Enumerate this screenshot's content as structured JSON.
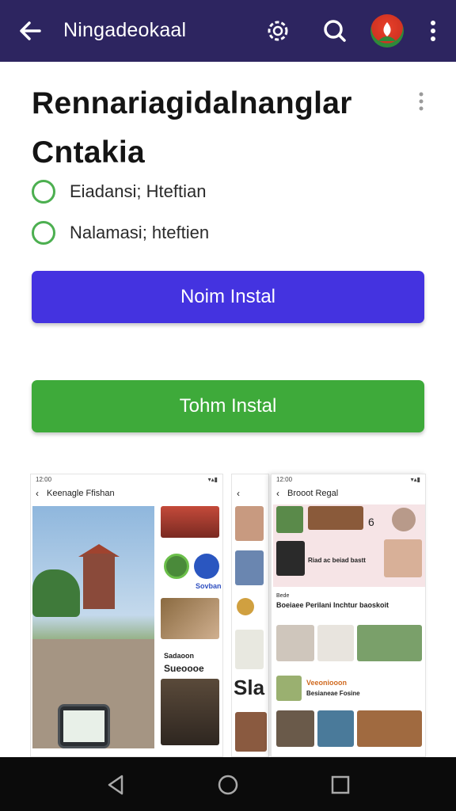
{
  "appbar": {
    "title": "Ningadeokaal",
    "icons": [
      "back-arrow-icon",
      "gear-icon",
      "search-icon",
      "avatar",
      "more-vert-icon"
    ],
    "color": "#2d2560"
  },
  "main": {
    "heading": "Rennariagidalnanglar Cntakia",
    "options": [
      {
        "label": "Eiadansi; Hteftian"
      },
      {
        "label": "Nalamasi; hteftien"
      }
    ],
    "buttons": {
      "primary": "Noim Instal",
      "secondary": "Tohm Instal"
    }
  },
  "previews": {
    "screen1": {
      "title": "Keenagle Ffishan",
      "status_time": "12:00",
      "side_label_1": "Sovban",
      "side_label_2": "Sadaoon",
      "side_label_2_sub": "Sueoooe"
    },
    "screen2": {
      "big_letter": "Sla"
    },
    "screen3": {
      "title": "Brooot Regal",
      "status_time": "12:00",
      "promo_text": "Riad ac beiad bastt",
      "number": "6",
      "section_small": "Bede",
      "section_heading": "Boeiaee Perilani Inchtur baoskoit",
      "item_title": "Veeoniooon",
      "item_sub": "Besianeae Fosine"
    }
  },
  "colors": {
    "primary_button": "#4433e0",
    "secondary_button": "#3eaa3a",
    "radio_border": "#4caf50"
  }
}
